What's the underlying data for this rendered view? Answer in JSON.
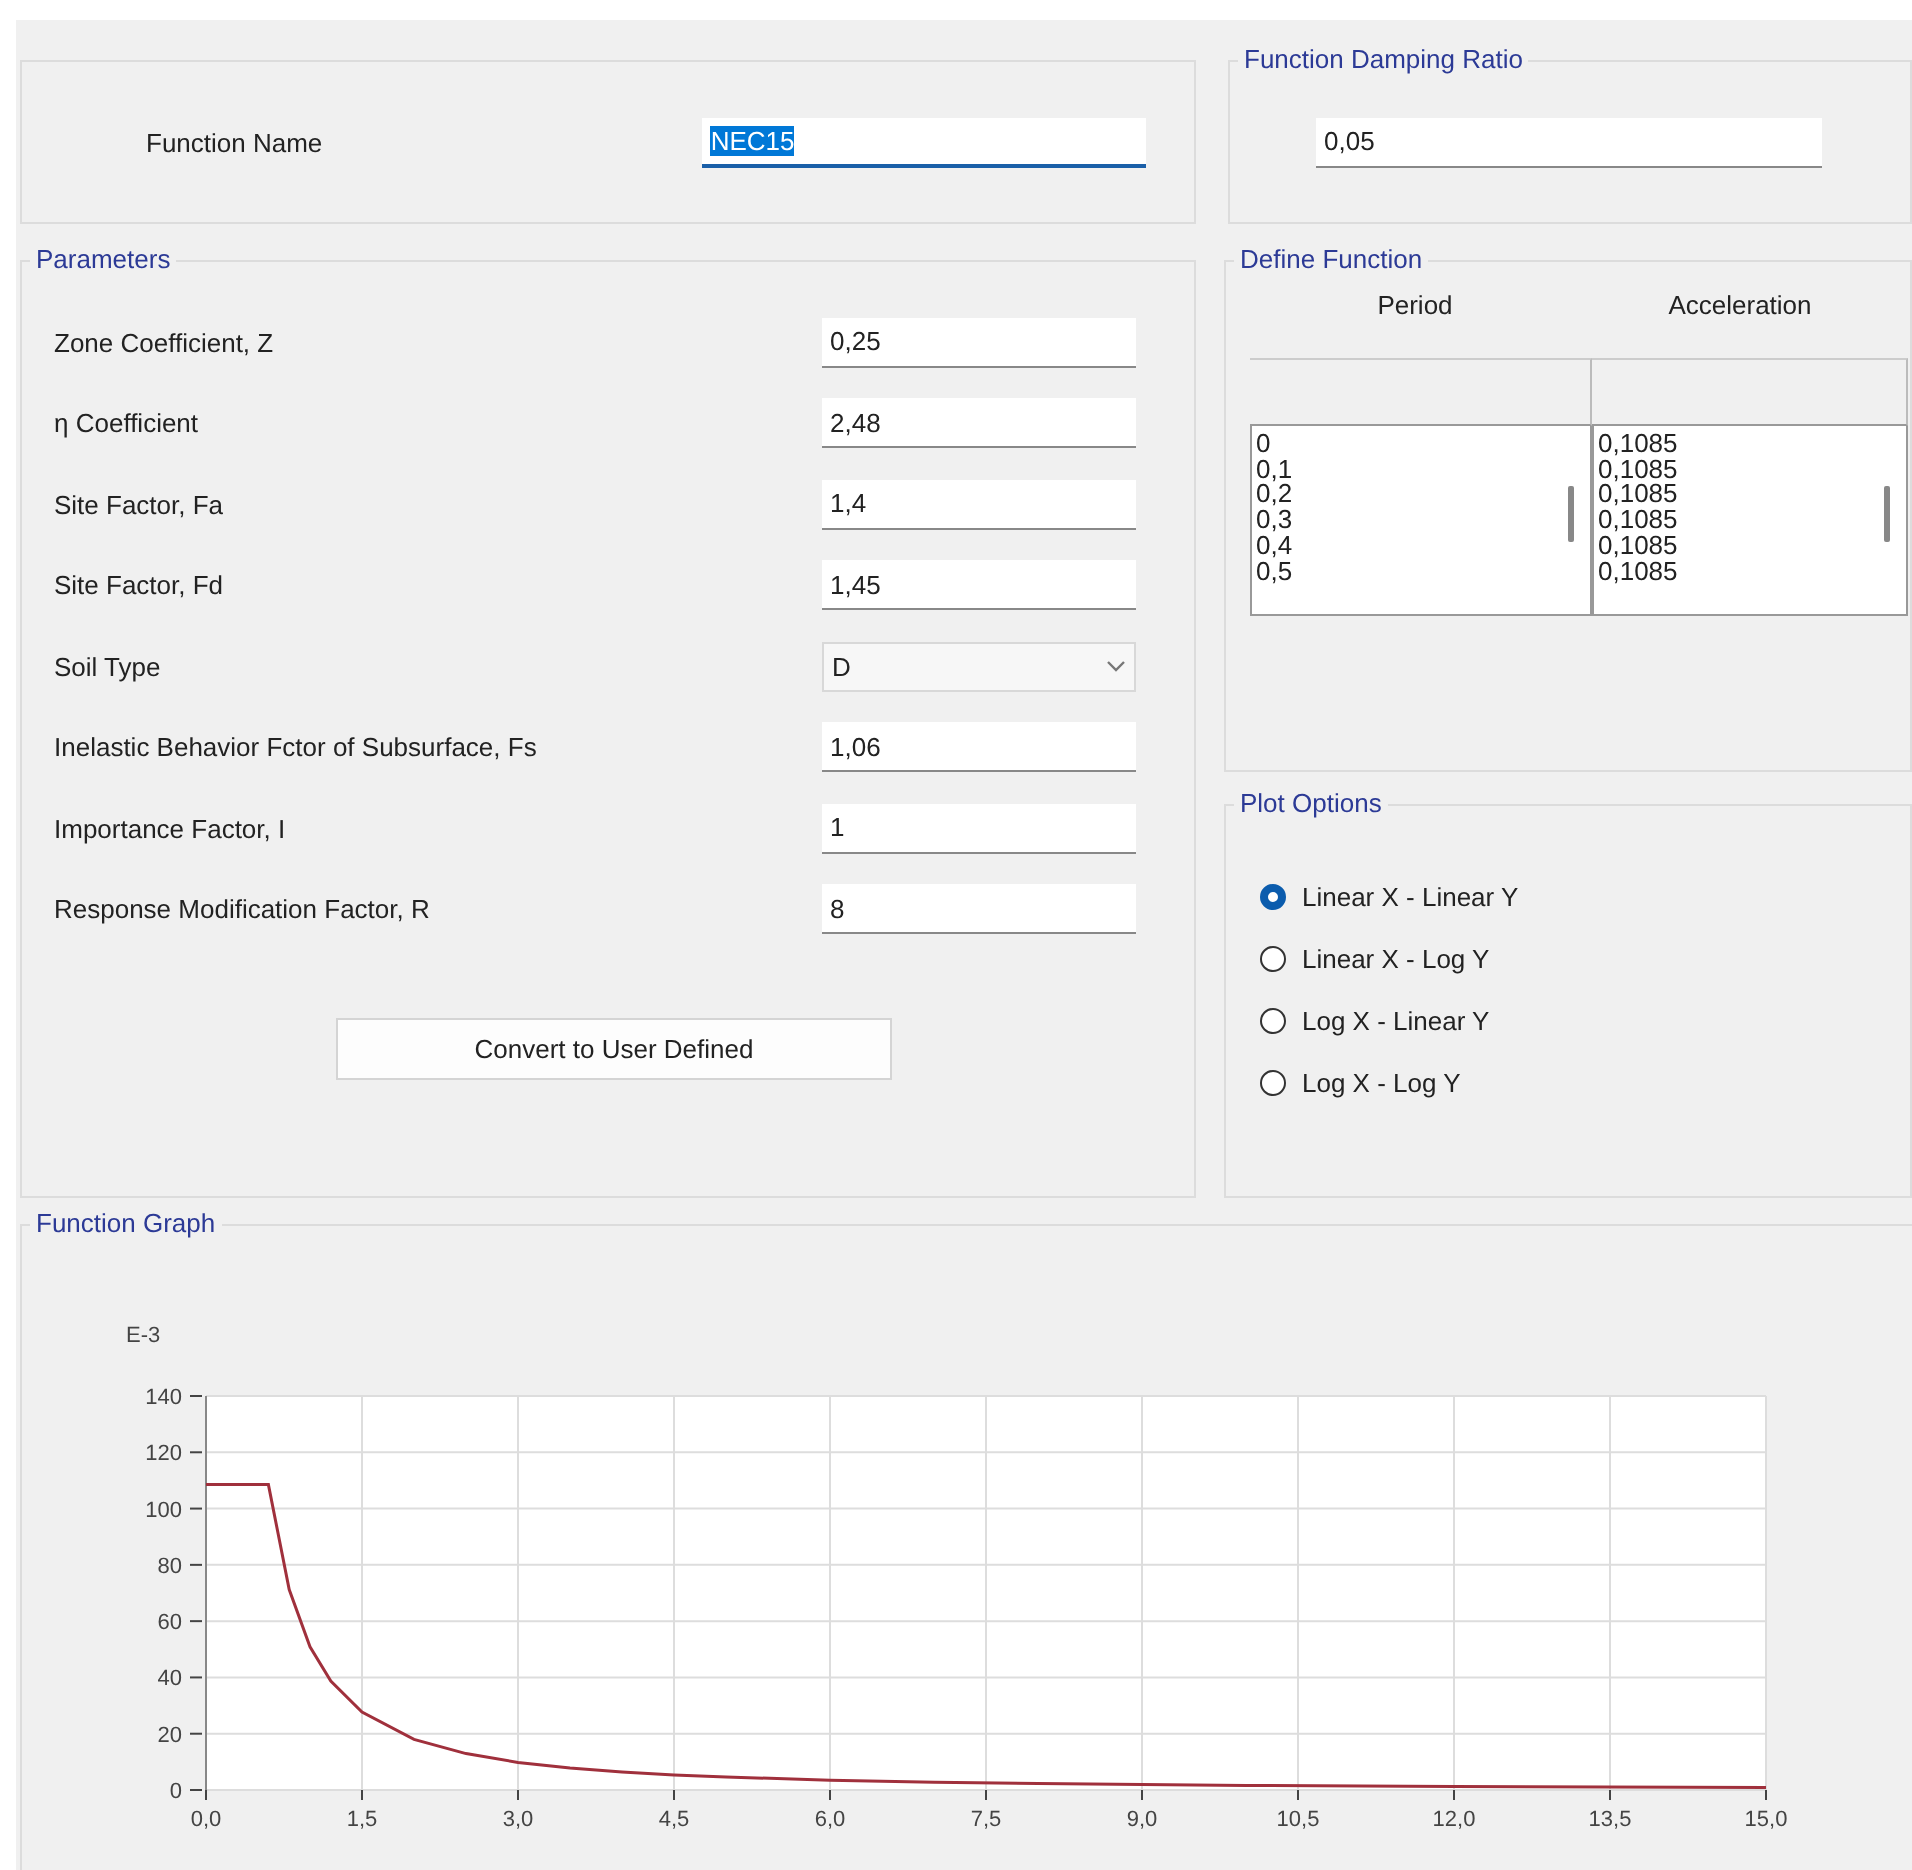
{
  "function_name": {
    "label": "Function Name",
    "value": "NEC15",
    "text_selected": true,
    "focused": true
  },
  "damping": {
    "title": "Function Damping Ratio",
    "value": "0,05"
  },
  "parameters": {
    "title": "Parameters",
    "rows": [
      {
        "kind": "text",
        "label": "Zone Coefficient, Z",
        "value": "0,25"
      },
      {
        "kind": "text",
        "label": "η Coefficient",
        "value": "2,48"
      },
      {
        "kind": "text",
        "label": "Site Factor, Fa",
        "value": "1,4"
      },
      {
        "kind": "text",
        "label": "Site Factor, Fd",
        "value": "1,45"
      },
      {
        "kind": "dropdown",
        "label": "Soil Type",
        "value": "D"
      },
      {
        "kind": "text",
        "label": "Inelastic Behavior Fctor of Subsurface, Fs",
        "value": "1,06"
      },
      {
        "kind": "text",
        "label": "Importance Factor, I",
        "value": "1"
      },
      {
        "kind": "text",
        "label": "Response Modification Factor, R",
        "value": "8"
      }
    ],
    "button": "Convert to User Defined"
  },
  "define_function": {
    "title": "Define Function",
    "columns": [
      "Period",
      "Acceleration"
    ],
    "lists": [
      [
        "0",
        "0,1",
        "0,2",
        "0,3",
        "0,4",
        "0,5"
      ],
      [
        "0,1085",
        "0,1085",
        "0,1085",
        "0,1085",
        "0,1085",
        "0,1085"
      ]
    ]
  },
  "plot_options": {
    "title": "Plot Options",
    "options": [
      {
        "label": "Linear X - Linear Y",
        "selected": true
      },
      {
        "label": "Linear X - Log Y",
        "selected": false
      },
      {
        "label": "Log X - Linear Y",
        "selected": false
      },
      {
        "label": "Log X - Log Y",
        "selected": false
      }
    ]
  },
  "function_graph": {
    "title": "Function Graph",
    "chart_data": {
      "type": "line",
      "ylabel": "E-3",
      "x": [
        0,
        0.6,
        0.8,
        1,
        1.2,
        1.5,
        2,
        2.5,
        3,
        3.5,
        4,
        4.5,
        5,
        6,
        7,
        8,
        9,
        10,
        12,
        15
      ],
      "grid": true,
      "series": [
        {
          "color": "#a0303c",
          "values": [
            108.5,
            108.5,
            71.2,
            50.9,
            38.7,
            27.7,
            18,
            12.9,
            9.8,
            7.8,
            6.4,
            5.3,
            4.6,
            3.5,
            2.8,
            2.3,
            1.9,
            1.6,
            1.2,
            0.9
          ]
        }
      ],
      "xlim": [
        0,
        15
      ],
      "ylim": [
        0,
        140
      ],
      "xticks": [
        {
          "value": 0,
          "label": "0,0"
        },
        {
          "value": 1.5,
          "label": "1,5"
        },
        {
          "value": 3,
          "label": "3,0"
        },
        {
          "value": 4.5,
          "label": "4,5"
        },
        {
          "value": 6,
          "label": "6,0"
        },
        {
          "value": 7.5,
          "label": "7,5"
        },
        {
          "value": 9,
          "label": "9,0"
        },
        {
          "value": 10.5,
          "label": "10,5"
        },
        {
          "value": 12,
          "label": "12,0"
        },
        {
          "value": 13.5,
          "label": "13,5"
        },
        {
          "value": 15,
          "label": "15,0"
        }
      ],
      "yticks": [
        0,
        20,
        40,
        60,
        80,
        100,
        120,
        140
      ]
    }
  }
}
